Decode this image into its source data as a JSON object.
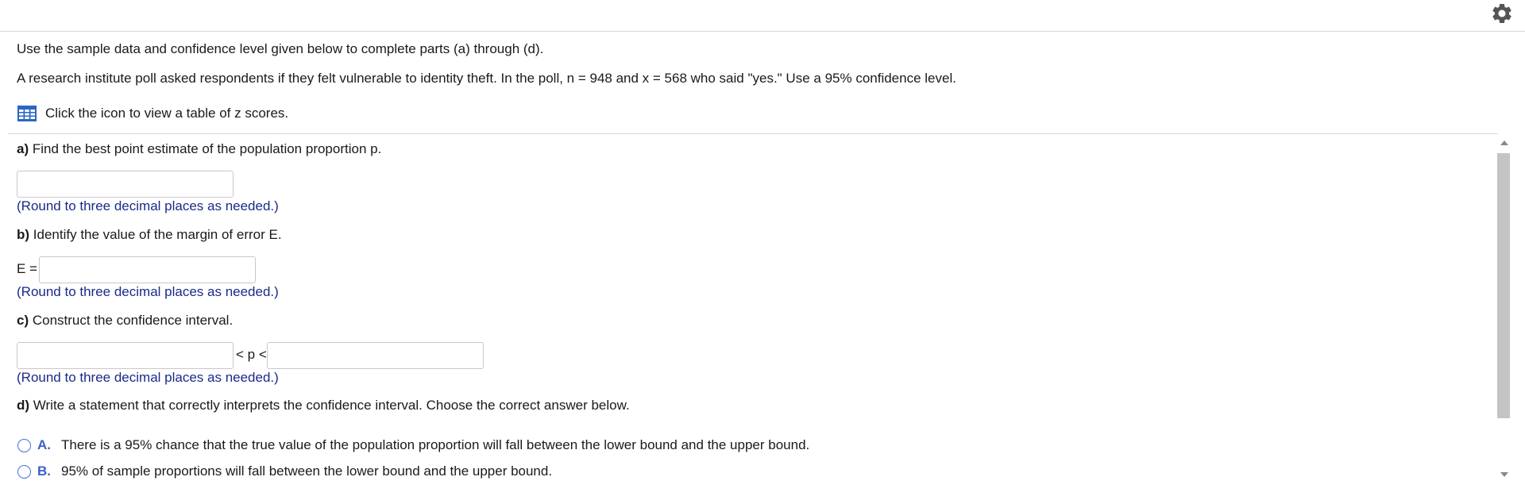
{
  "intro_text": "Use the sample data and confidence level given below to complete parts (a) through (d).",
  "problem_text": "A research institute poll asked respondents if they felt vulnerable to identity theft. In the poll, n = 948 and x = 568 who said \"yes.\" Use a 95% confidence level.",
  "ztable_link": {
    "icon": "table-grid-icon",
    "label": "Click the icon to view a table of z scores."
  },
  "parts": {
    "a": {
      "letter": "a)",
      "question": "Find the best point estimate of the population proportion p.",
      "answer_value": "",
      "hint": "(Round to three decimal places as needed.)"
    },
    "b": {
      "letter": "b)",
      "question": "Identify the value of the margin of error E.",
      "prefix": "E =",
      "answer_value": "",
      "hint": "(Round to three decimal places as needed.)"
    },
    "c": {
      "letter": "c)",
      "question": "Construct the confidence interval.",
      "middle": "< p <",
      "lower_value": "",
      "upper_value": "",
      "hint": "(Round to three decimal places as needed.)"
    },
    "d": {
      "letter": "d)",
      "question": "Write a statement that correctly interprets the confidence interval. Choose the correct answer below.",
      "options": [
        {
          "letter": "A.",
          "text": "There is a 95% chance that the true value of the population proportion will fall between the lower bound and the upper bound."
        },
        {
          "letter": "B.",
          "text": "95% of sample proportions will fall between the lower bound and the upper bound."
        }
      ]
    }
  },
  "colors": {
    "hint": "#1a2a8a",
    "option_letter": "#3a5fc9",
    "radio_border": "#4a6fd4",
    "icon_blue": "#2b66c4",
    "gear": "#555555"
  }
}
